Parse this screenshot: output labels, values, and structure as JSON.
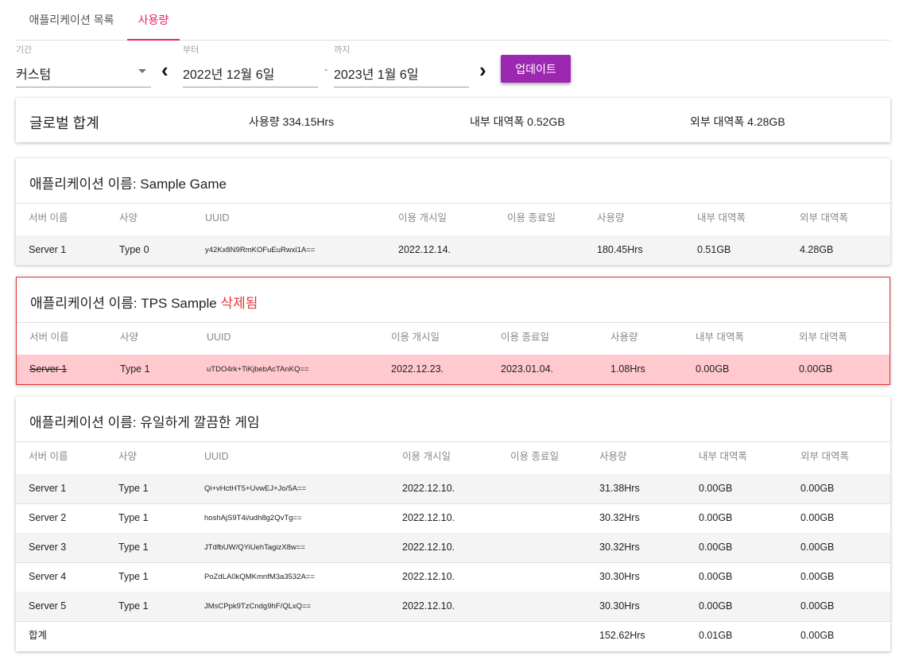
{
  "tabs": [
    "애플리케이션 목록",
    "사용량"
  ],
  "filters": {
    "period_label": "기간",
    "period_value": "커스텀",
    "from_label": "부터",
    "from_value": "2022년 12월 6일",
    "to_label": "까지",
    "to_value": "2023년 1월 6일",
    "separator": "-",
    "update_button": "업데이트"
  },
  "global": {
    "title": "글로벌 합계",
    "usage": "사용량 334.15Hrs",
    "internal": "내부 대역폭 0.52GB",
    "external": "외부 대역폭 4.28GB"
  },
  "columns": [
    "서버 이름",
    "사양",
    "UUID",
    "이용 개시일",
    "이용 종료일",
    "사용량",
    "내부 대역폭",
    "외부 대역폭"
  ],
  "apps": [
    {
      "title": "애플리케이션 이름: Sample Game",
      "deleted_label": "",
      "rows": [
        [
          "Server 1",
          "Type 0",
          "y42Kx8N9RmKOFuEuRwxl1A==",
          "2022.12.14.",
          "",
          "180.45Hrs",
          "0.51GB",
          "4.28GB"
        ]
      ]
    },
    {
      "title": "애플리케이션 이름: TPS Sample",
      "deleted_label": "삭제됨",
      "rows": [
        [
          "Server 1",
          "Type 1",
          "uTDO4rk+TiKjbebAcTAnKQ==",
          "2022.12.23.",
          "2023.01.04.",
          "1.08Hrs",
          "0.00GB",
          "0.00GB"
        ]
      ]
    },
    {
      "title": "애플리케이션 이름: 유일하게 깔끔한 게임",
      "deleted_label": "",
      "rows": [
        [
          "Server 1",
          "Type 1",
          "Qi+vHctHT5+UvwEJ+Jo/5A==",
          "2022.12.10.",
          "",
          "31.38Hrs",
          "0.00GB",
          "0.00GB"
        ],
        [
          "Server 2",
          "Type 1",
          "hoshAjS9T4i/udh8g2QvTg==",
          "2022.12.10.",
          "",
          "30.32Hrs",
          "0.00GB",
          "0.00GB"
        ],
        [
          "Server 3",
          "Type 1",
          "JTdfbUW/QYiUehTagizX8w==",
          "2022.12.10.",
          "",
          "30.32Hrs",
          "0.00GB",
          "0.00GB"
        ],
        [
          "Server 4",
          "Type 1",
          "PoZdLA0kQMKmnfM3a3532A==",
          "2022.12.10.",
          "",
          "30.30Hrs",
          "0.00GB",
          "0.00GB"
        ],
        [
          "Server 5",
          "Type 1",
          "JMsCPpk9TzCndg9hF/QLxQ==",
          "2022.12.10.",
          "",
          "30.30Hrs",
          "0.00GB",
          "0.00GB"
        ]
      ],
      "total": [
        "합계",
        "",
        "",
        "",
        "",
        "152.62Hrs",
        "0.01GB",
        "0.00GB"
      ]
    }
  ],
  "colors": {
    "accent": "#e91e63",
    "button": "#9c27b0",
    "deleted": "#e53935",
    "deleted_row": "#ffc9cf"
  }
}
